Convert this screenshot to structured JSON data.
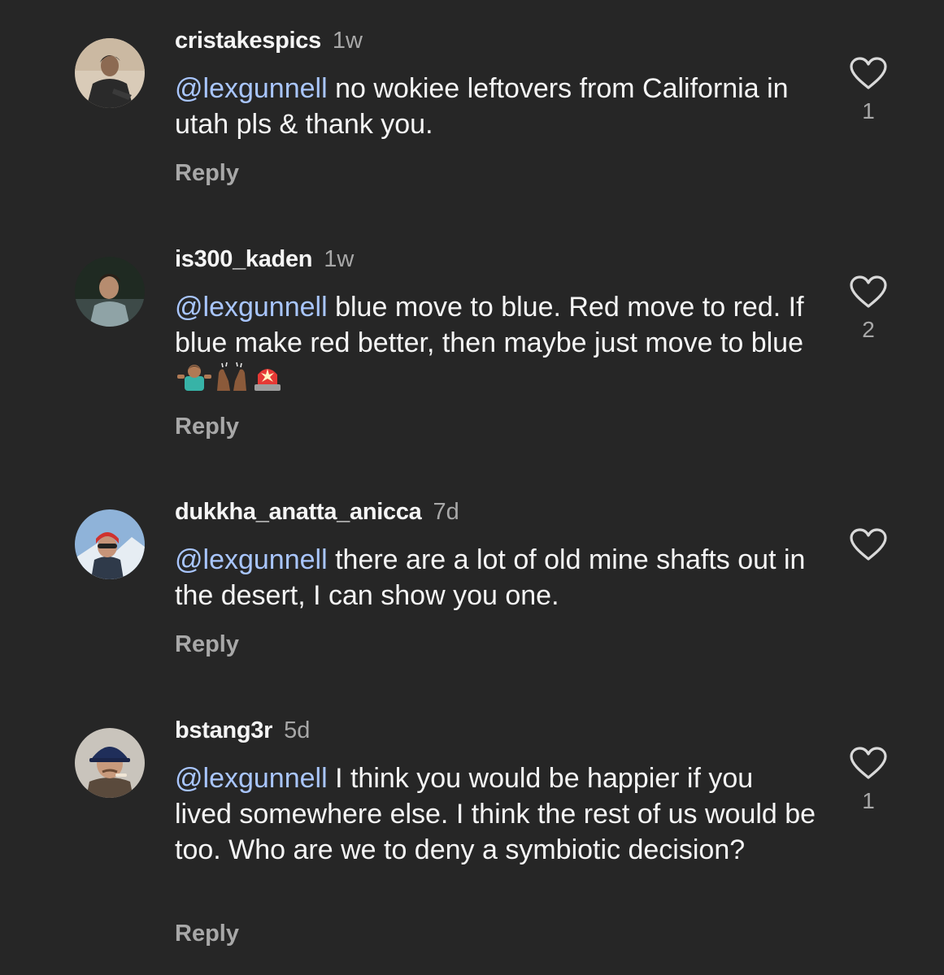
{
  "comments": [
    {
      "username": "cristakespics",
      "time": "1w",
      "mention": "@lexgunnell",
      "text": " no wokiee leftovers from California in utah pls & thank you.",
      "reply_label": "Reply",
      "like_count": "1",
      "like_icon": "heart-outline-icon"
    },
    {
      "username": "is300_kaden",
      "time": "1w",
      "mention": "@lexgunnell",
      "text": " blue move to blue. Red move to red. If blue make red better, then maybe just move to blue",
      "emojis": [
        "person-shrugging-emoji",
        "raising-hands-emoji",
        "police-light-emoji"
      ],
      "reply_label": "Reply",
      "like_count": "2",
      "like_icon": "heart-outline-icon"
    },
    {
      "username": "dukkha_anatta_anicca",
      "time": "7d",
      "mention": "@lexgunnell",
      "text": " there are a lot of old mine shafts out in the desert, I can show you one.",
      "reply_label": "Reply",
      "like_count": "",
      "like_icon": "heart-outline-icon"
    },
    {
      "username": "bstang3r",
      "time": "5d",
      "mention": "@lexgunnell",
      "text": " I think you would be happier if you lived somewhere else. I think the rest of us would be too. Who are we to deny a symbiotic decision?",
      "reply_label": "Reply",
      "like_count": "1",
      "like_icon": "heart-outline-icon"
    }
  ],
  "colors": {
    "background": "#262626",
    "text": "#f5f5f5",
    "secondary": "#a8a8a8",
    "mention": "#a9c6ff"
  }
}
